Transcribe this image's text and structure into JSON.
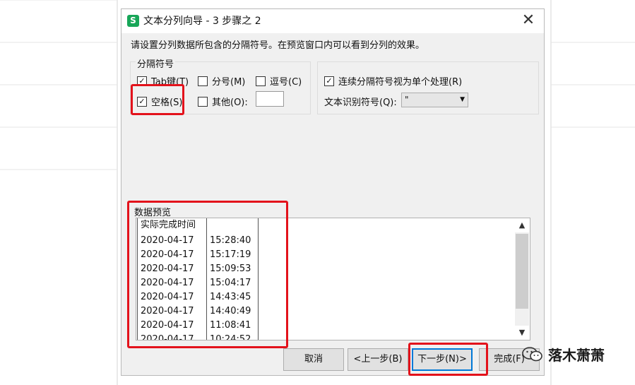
{
  "dialog": {
    "app_icon": "S",
    "title": "文本分列向导 - 3 步骤之 2",
    "close": "✕",
    "instruction": "请设置分列数据所包含的分隔符号。在预览窗口内可以看到分列的效果。"
  },
  "delimiters": {
    "group_title": "分隔符号",
    "tab": {
      "label": "Tab键(T)",
      "checked": true
    },
    "semicolon": {
      "label": "分号(M)",
      "checked": false
    },
    "comma": {
      "label": "逗号(C)",
      "checked": false
    },
    "space": {
      "label": "空格(S)",
      "checked": true
    },
    "other": {
      "label": "其他(O):",
      "checked": false,
      "value": ""
    },
    "consecutive": {
      "label": "连续分隔符号视为单个处理(R)",
      "checked": true
    },
    "qualifier_label": "文本识别符号(Q):",
    "qualifier_value": "\""
  },
  "preview": {
    "label": "数据预览",
    "rows": [
      [
        "实际完成时间",
        ""
      ],
      [
        "2020-04-17",
        "15:28:40"
      ],
      [
        "2020-04-17",
        "15:17:19"
      ],
      [
        "2020-04-17",
        "15:09:53"
      ],
      [
        "2020-04-17",
        "15:04:17"
      ],
      [
        "2020-04-17",
        "14:43:45"
      ],
      [
        "2020-04-17",
        "14:40:49"
      ],
      [
        "2020-04-17",
        "11:08:41"
      ],
      [
        "2020-04-17",
        "10:24:52"
      ]
    ]
  },
  "buttons": {
    "cancel": "取消",
    "back": "<上一步(B)",
    "next": "下一步(N)>",
    "finish": "完成(F)"
  },
  "watermark": {
    "text": "落木萧萧",
    "icon": "wechat-icon"
  },
  "colors": {
    "highlight": "#e3121b",
    "app_icon": "#17a658",
    "default_button_border": "#0078d7"
  }
}
